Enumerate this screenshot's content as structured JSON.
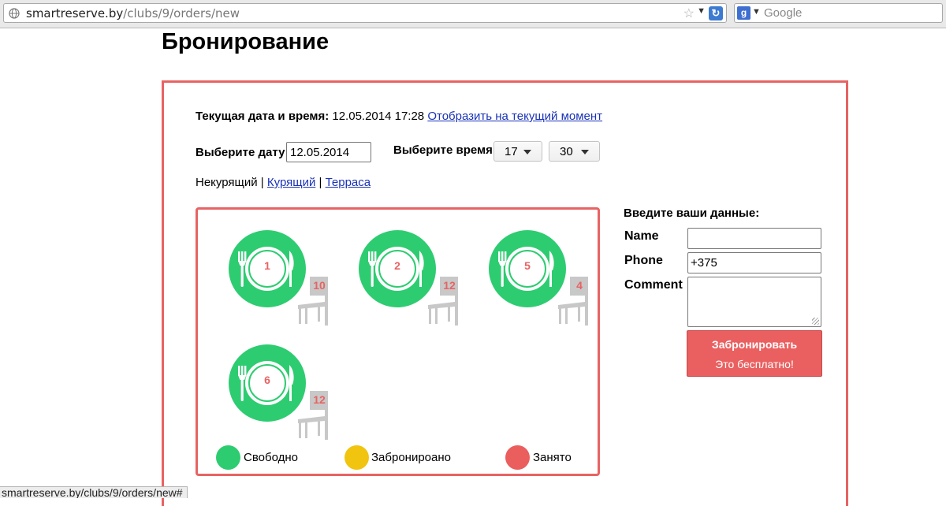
{
  "browser": {
    "url_host": "smartreserve.by",
    "url_path": "/clubs/9/orders/new",
    "search_placeholder": "Google",
    "status_text": "smartreserve.by/clubs/9/orders/new#"
  },
  "page": {
    "title": "Бронирование",
    "current_label": "Текущая дата и время:",
    "current_value": "12.05.2014 17:28",
    "current_link": "Отобразить на текущий момент",
    "date_label": "Выберите дату",
    "date_value": "12.05.2014",
    "time_label": "Выберите время",
    "hour_value": "17",
    "minute_value": "30",
    "zones": {
      "active": "Некурящий",
      "sep1": " | ",
      "smoking": "Курящий",
      "sep2": " | ",
      "terrace": "Терраса"
    }
  },
  "tables": [
    {
      "number": "1",
      "seats": "10",
      "status": "free"
    },
    {
      "number": "2",
      "seats": "12",
      "status": "free"
    },
    {
      "number": "5",
      "seats": "4",
      "status": "free"
    },
    {
      "number": "6",
      "seats": "12",
      "status": "free"
    }
  ],
  "legend": {
    "free": {
      "label": "Свободно",
      "color": "#2ecc71"
    },
    "booked": {
      "label": "Забронироано",
      "color": "#f1c40f"
    },
    "taken": {
      "label": "Занято",
      "color": "#eb5e5e"
    }
  },
  "form": {
    "title": "Введите ваши данные:",
    "name_label": "Name",
    "name_value": "",
    "phone_label": "Phone",
    "phone_value": "+375",
    "comment_label": "Comment",
    "comment_value": "",
    "submit_label": "Забронировать",
    "submit_sub": "Это бесплатно!"
  },
  "colors": {
    "accent_red": "#e86363",
    "table_green": "#2ecc71",
    "chair_gray": "#c8c8c8",
    "link_blue": "#1a33b8"
  }
}
